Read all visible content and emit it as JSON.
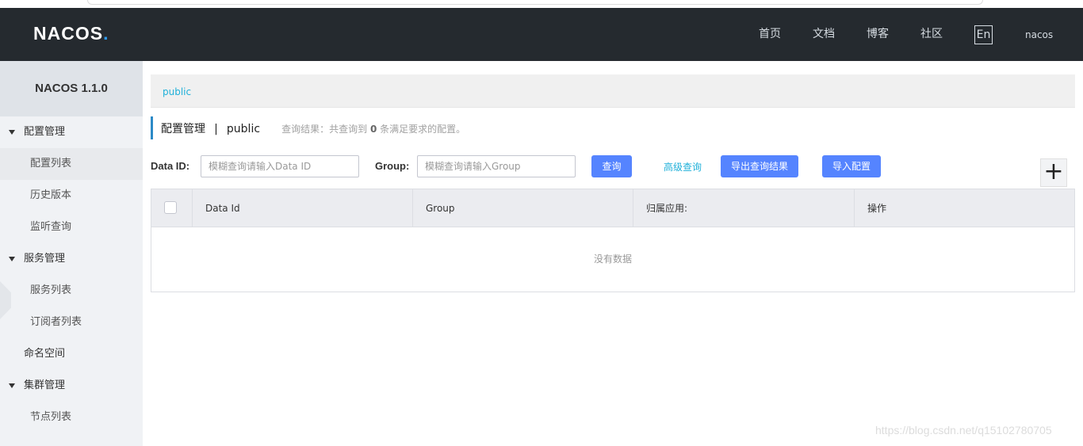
{
  "header": {
    "logo": "NACOS",
    "logo_dot": ".",
    "nav": [
      "首页",
      "文档",
      "博客",
      "社区"
    ],
    "lang": "En",
    "user": "nacos"
  },
  "sidebar": {
    "title": "NACOS 1.1.0",
    "config_group": "配置管理",
    "config_items": [
      "配置列表",
      "历史版本",
      "监听查询"
    ],
    "service_group": "服务管理",
    "service_items": [
      "服务列表",
      "订阅者列表"
    ],
    "namespace": "命名空间",
    "cluster_group": "集群管理",
    "cluster_items": [
      "节点列表"
    ]
  },
  "namespace_bar": {
    "current": "public"
  },
  "breadcrumb": {
    "title": "配置管理",
    "sep": "|",
    "ns": "public",
    "hint_prefix": "查询结果：共查询到",
    "hint_count": "0",
    "hint_suffix": "条满足要求的配置。"
  },
  "filters": {
    "dataid_label": "Data ID:",
    "dataid_placeholder": "模糊查询请输入Data ID",
    "group_label": "Group:",
    "group_placeholder": "模糊查询请输入Group",
    "search_btn": "查询",
    "advanced_link": "高级查询",
    "export_btn": "导出查询结果",
    "import_btn": "导入配置",
    "add_btn": "+"
  },
  "table": {
    "columns": [
      "Data Id",
      "Group",
      "归属应用:",
      "操作"
    ],
    "empty_text": "没有数据"
  },
  "watermark": "https://blog.csdn.net/q15102780705"
}
